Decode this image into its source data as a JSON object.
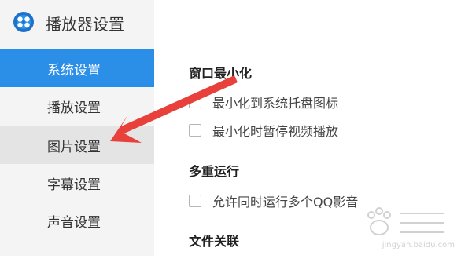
{
  "app": {
    "title": "播放器设置",
    "logo_icon": "qq-player-logo-icon"
  },
  "sidebar": {
    "items": [
      {
        "label": "系统设置",
        "state": "active"
      },
      {
        "label": "播放设置",
        "state": "normal"
      },
      {
        "label": "图片设置",
        "state": "hover"
      },
      {
        "label": "字幕设置",
        "state": "normal"
      },
      {
        "label": "声音设置",
        "state": "normal"
      },
      {
        "label": "",
        "state": "partial"
      }
    ]
  },
  "sections": [
    {
      "title": "窗口最小化",
      "options": [
        {
          "label": "最小化到系统托盘图标",
          "checked": false
        },
        {
          "label": "最小化时暂停视频播放",
          "checked": false
        }
      ]
    },
    {
      "title": "多重运行",
      "options": [
        {
          "label": "允许同时运行多个QQ影音",
          "checked": false
        }
      ]
    },
    {
      "title": "文件关联",
      "options": []
    }
  ],
  "watermark": {
    "url": "jingyan.baidu.com"
  },
  "colors": {
    "accent": "#2b8fe8",
    "arrow": "#e8403a",
    "sidebar_bg": "#f4f4f4",
    "hover_bg": "#e4e4e4"
  }
}
